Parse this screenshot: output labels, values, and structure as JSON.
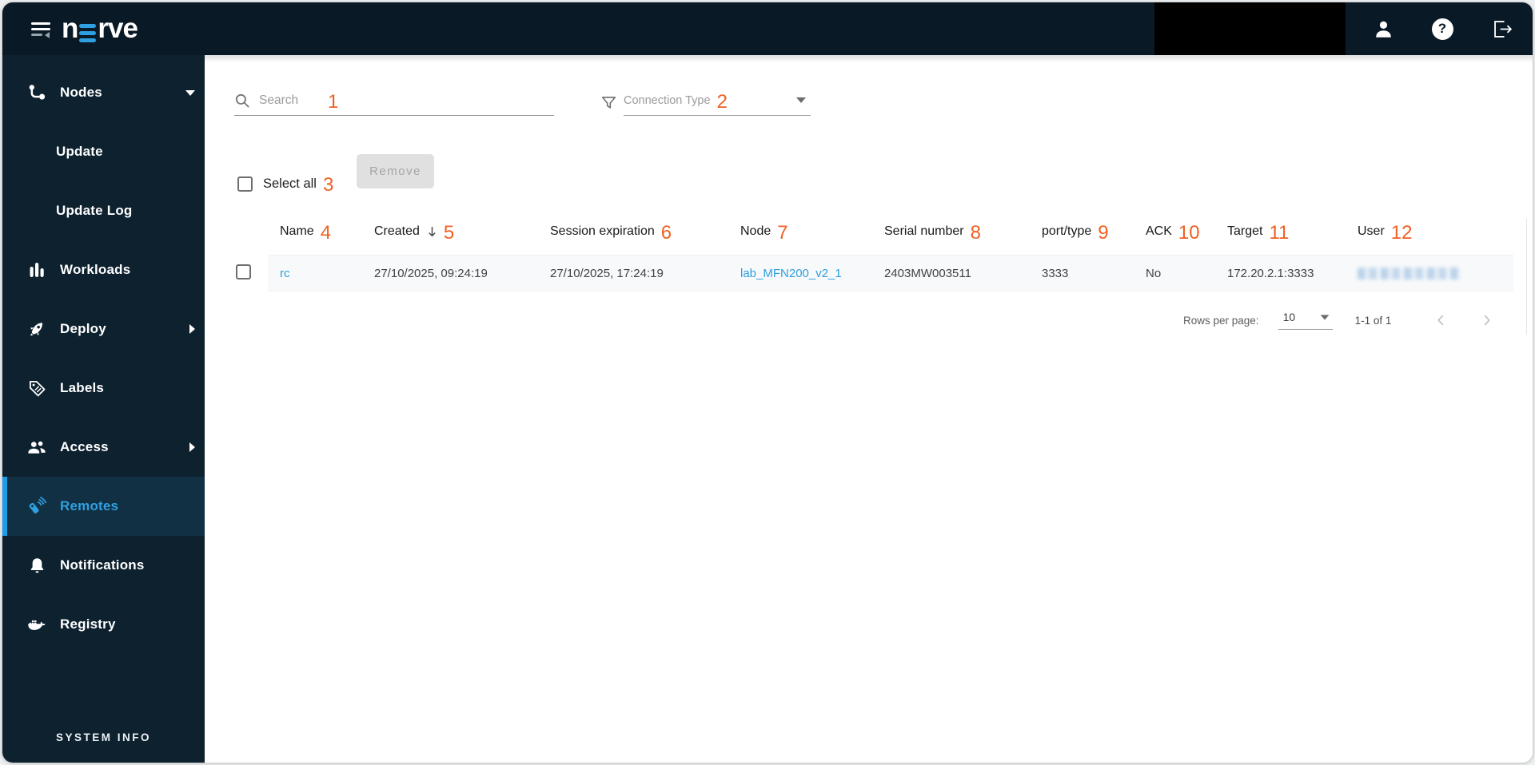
{
  "topbar": {
    "logo_left": "n",
    "logo_right": "rve",
    "help_glyph": "?"
  },
  "sidebar": {
    "items": [
      {
        "label": "Nodes"
      },
      {
        "label": "Update"
      },
      {
        "label": "Update Log"
      },
      {
        "label": "Workloads"
      },
      {
        "label": "Deploy"
      },
      {
        "label": "Labels"
      },
      {
        "label": "Access"
      },
      {
        "label": "Remotes"
      },
      {
        "label": "Notifications"
      },
      {
        "label": "Registry"
      }
    ],
    "selected_item": "Remotes",
    "footer_label": "SYSTEM INFO"
  },
  "filters": {
    "search": {
      "placeholder": "Search",
      "annotation": "1"
    },
    "connection_type": {
      "label": "Connection Type",
      "annotation": "2"
    }
  },
  "toolbar": {
    "select_all_label": "Select all",
    "select_all_annotation": "3",
    "remove_label": "Remove"
  },
  "table": {
    "headers": [
      {
        "label": "Name",
        "annotation": "4"
      },
      {
        "label": "Created",
        "annotation": "5",
        "sorted": "desc"
      },
      {
        "label": "Session expiration",
        "annotation": "6"
      },
      {
        "label": "Node",
        "annotation": "7"
      },
      {
        "label": "Serial number",
        "annotation": "8"
      },
      {
        "label": "port/type",
        "annotation": "9"
      },
      {
        "label": "ACK",
        "annotation": "10"
      },
      {
        "label": "Target",
        "annotation": "11"
      },
      {
        "label": "User",
        "annotation": "12"
      }
    ],
    "rows": [
      {
        "name": "rc",
        "created": "27/10/2025, 09:24:19",
        "session_expiration": "27/10/2025, 17:24:19",
        "node": "lab_MFN200_v2_1",
        "serial_number": "2403MW003511",
        "port_type": "3333",
        "ack": "No",
        "target": "172.20.2.1:3333",
        "user_redacted": true
      }
    ]
  },
  "pagination": {
    "rows_per_page_label": "Rows per page:",
    "rows_per_page_value": "10",
    "range_label": "1-1 of 1"
  },
  "colors": {
    "topbar_navy": "#0a1926",
    "sidebar_navy": "#0d212f",
    "accent_blue": "#1e9be9",
    "link_blue": "#2e9fe0",
    "annotation_orange": "#ee6123"
  }
}
